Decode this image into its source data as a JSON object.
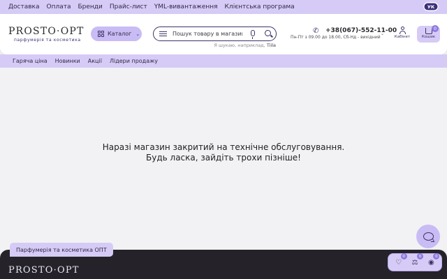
{
  "topbar": {
    "links": [
      "Доставка",
      "Оплата",
      "Бренди",
      "Прайс-лист",
      "YML-вивантаження",
      "Клієнтська програма"
    ],
    "lang": "УК"
  },
  "header": {
    "logo_main": "PROSTO·OPT",
    "logo_sub": "парфумерія та косметика",
    "catalog_label": "Каталог",
    "search_placeholder": "Пошук товару в магазині",
    "search_hint_prefix": "Я шукаю, наприклад,",
    "search_hint_example": "Tiila",
    "phone": "+38(067)-552-11-00",
    "hours": "Пн-Пт з 09.00 до 18.00, Сб-Нд - вихідний",
    "cabinet_label": "Кабінет",
    "cart_label": "Кошик",
    "cart_count": "0"
  },
  "subnav": {
    "items": [
      "Гаряча ціна",
      "Новинки",
      "Акції",
      "Лідери продажу"
    ]
  },
  "main": {
    "line1": "Наразі магазин закритий на технічне обслуговування.",
    "line2": "Будь ласка, зайдіть трохи пізніше!"
  },
  "footer": {
    "tag": "Парфумерія та косметика ОПТ",
    "logo": "PROSTO·OPT"
  },
  "floatbar": {
    "wishlist_count": "0",
    "compare_count": "0",
    "viewed_count": "0"
  },
  "icons": {
    "catalog": "grid-icon",
    "filter": "sliders-icon",
    "mic": "microphone-icon",
    "search": "search-icon",
    "phone": "phone-icon",
    "user": "user-icon",
    "cart": "cart-icon",
    "chat": "chat-bubble-icon",
    "wishlist": "heart-icon",
    "compare": "scales-icon",
    "viewed": "eye-icon"
  },
  "colors": {
    "accent_light": "#d6cbf6",
    "accent": "#c9bcf4",
    "badge": "#8f7be0",
    "dark": "#3b3366",
    "footer_bg": "#252329"
  }
}
